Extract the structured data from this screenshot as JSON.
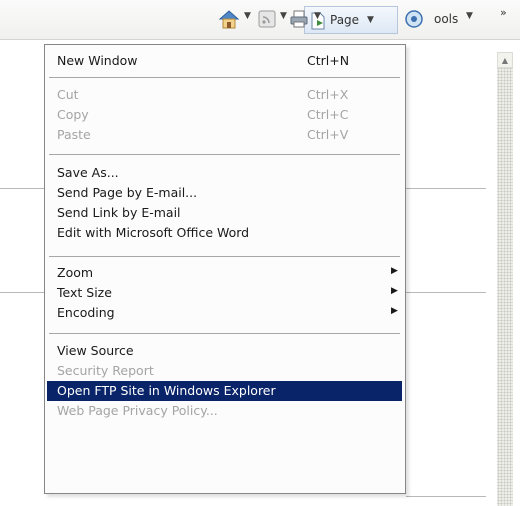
{
  "toolbar": {
    "page_label": "Page",
    "tools_label": "ools",
    "overflow_label": "»",
    "icons": [
      "home-icon",
      "feeds-icon",
      "print-icon",
      "page-icon",
      "tools-icon"
    ]
  },
  "menu": {
    "items": [
      {
        "label": "New Window",
        "shortcut": "Ctrl+N",
        "disabled": false
      },
      {
        "label": "Cut",
        "shortcut": "Ctrl+X",
        "disabled": true
      },
      {
        "label": "Copy",
        "shortcut": "Ctrl+C",
        "disabled": true
      },
      {
        "label": "Paste",
        "shortcut": "Ctrl+V",
        "disabled": true
      },
      {
        "label": "Save As...",
        "shortcut": "",
        "disabled": false
      },
      {
        "label": "Send Page by E-mail...",
        "shortcut": "",
        "disabled": false
      },
      {
        "label": "Send Link by E-mail",
        "shortcut": "",
        "disabled": false
      },
      {
        "label": "Edit with Microsoft Office Word",
        "shortcut": "",
        "disabled": false
      },
      {
        "label": "Zoom",
        "shortcut": "",
        "submenu": true,
        "disabled": false
      },
      {
        "label": "Text Size",
        "shortcut": "",
        "submenu": true,
        "disabled": false
      },
      {
        "label": "Encoding",
        "shortcut": "",
        "submenu": true,
        "disabled": false
      },
      {
        "label": "View Source",
        "shortcut": "",
        "disabled": false
      },
      {
        "label": "Security Report",
        "shortcut": "",
        "disabled": true
      },
      {
        "label": "Open FTP Site in Windows Explorer",
        "shortcut": "",
        "disabled": false,
        "selected": true
      },
      {
        "label": "Web Page Privacy Policy...",
        "shortcut": "",
        "disabled": true
      }
    ]
  },
  "colors": {
    "selection": "#0a246a",
    "disabled_text": "#a4a4a4",
    "menu_border": "#868686"
  }
}
